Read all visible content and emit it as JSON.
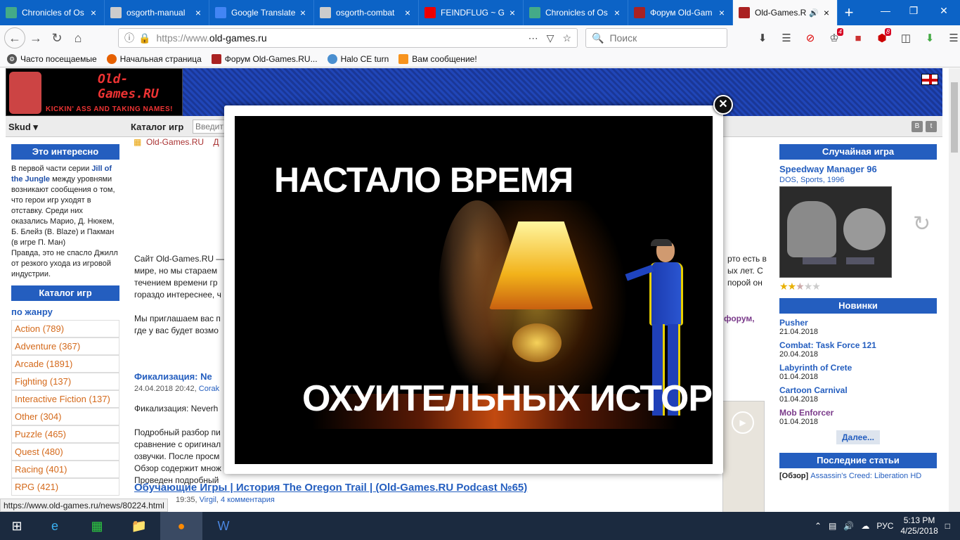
{
  "tabs": [
    {
      "title": "Chronicles of Os",
      "icon": "page-icon",
      "color": "#4a8"
    },
    {
      "title": "osgorth-manual",
      "icon": "page-icon",
      "color": "#ccc"
    },
    {
      "title": "Google Translate",
      "icon": "google-translate-icon",
      "color": "#4285f4"
    },
    {
      "title": "osgorth-combat",
      "icon": "page-icon",
      "color": "#ccc"
    },
    {
      "title": "FEINDFLUG ~ Gr",
      "icon": "youtube-icon",
      "color": "#e00"
    },
    {
      "title": "Chronicles of Os",
      "icon": "page-icon",
      "color": "#4a8"
    },
    {
      "title": "Форум Old-Gam",
      "icon": "oldgames-icon",
      "color": "#a22"
    },
    {
      "title": "Old-Games.R",
      "icon": "oldgames-icon",
      "color": "#a22",
      "active": true
    }
  ],
  "nav": {
    "url_protocol": "https://www.",
    "url_host": "old-games.ru",
    "search_placeholder": "Поиск",
    "badge_notifications": "4",
    "badge_adblock": "8"
  },
  "bookmarks": [
    "Часто посещаемые",
    "Начальная страница",
    "Форум Old-Games.RU...",
    "Halo CE turn",
    "Вам сообщение!"
  ],
  "header": {
    "logo_title": "Old-Games.RU",
    "logo_slogan": "KICKIN' ASS AND TAKING NAMES!"
  },
  "subbar": {
    "user": "Skud",
    "catalog_label": "Каталог игр",
    "search_placeholder": "Введит"
  },
  "left": {
    "interesting_title": "Это интересно",
    "interesting_pre": "В первой части серии",
    "interesting_link": "Jill of the Jungle",
    "interesting_text": "между уровнями возникают сообщения о том, что герои игр уходят в отставку. Среди них оказались Марио, Д. Нюкем, Б. Блейз (В. Blaze) и Пакман (в игре П. Ман)",
    "interesting_text2": "Правда, это не спасло Джилл от резкого ухода из игровой индустрии.",
    "catalog_title": "Каталог игр",
    "by_genre": "по жанру",
    "genres": [
      "Action (789)",
      "Adventure (367)",
      "Arcade (1891)",
      "Fighting (137)",
      "Interactive Fiction (137)",
      "Other (304)",
      "Puzzle (465)",
      "Quest (480)",
      "Racing (401)",
      "RPG (421)"
    ]
  },
  "center": {
    "breadcrumb": "Old-Games.RU",
    "breadcrumb_cut": "Д",
    "intro1": "Сайт Old-Games.RU —",
    "intro2": "мире, но мы стараем",
    "intro3": "течением времени гр",
    "intro4": "гораздо интереснее, ч",
    "intro_r1": "рто есть в",
    "intro_r2": "ых лет. С",
    "intro_r3": "порой он",
    "invite": "Мы приглашаем вас п",
    "invite2": "где у вас будет возмо",
    "forum_link": "е форум",
    "news1_title": "Фикализация: Ne",
    "news1_date": "24.04.2018 20:42,",
    "news1_author": "Corak",
    "news1_l1": "Фикализация: Neverh",
    "news1_l2": "Подробный разбор пи",
    "news1_l3": "сравнение с оригинал",
    "news1_l4": "озвучки. После просм",
    "news1_l5": "Обзор содержит множ",
    "news1_l6": "Проведен подробный",
    "podcast_title": "Обучающие Игры | История The Oregon Trail | (Old-Games.RU Podcast №65)",
    "podcast_time": "19:35,",
    "podcast_author": "Virgil",
    "podcast_comments": "4 комментария"
  },
  "right": {
    "random_title": "Случайная игра",
    "random_game": "Speedway Manager 96",
    "random_meta1": "DOS",
    "random_meta2": "Sports",
    "random_meta3": "1996",
    "rating": 2.5,
    "new_title": "Новинки",
    "new_items": [
      {
        "name": "Pusher",
        "date": "21.04.2018"
      },
      {
        "name": "Combat: Task Force 121",
        "date": "20.04.2018"
      },
      {
        "name": "Labyrinth of Crete",
        "date": "01.04.2018"
      },
      {
        "name": "Cartoon Carnival",
        "date": "01.04.2018"
      },
      {
        "name": "Mob Enforcer",
        "date": "01.04.2018"
      }
    ],
    "more_label": "Далее...",
    "articles_title": "Последние статьи",
    "article_tag": "[Обзор]",
    "article_name": "Assassin's Creed: Liberation HD"
  },
  "modal": {
    "top_text": "НАСТАЛО ВРЕМЯ",
    "bottom_text": "ОХУИТЕЛЬНЫХ ИСТОРИЙ"
  },
  "status_url": "https://www.old-games.ru/news/80224.html",
  "taskbar": {
    "lang": "РУС",
    "time": "5:13 PM",
    "date": "4/25/2018"
  }
}
